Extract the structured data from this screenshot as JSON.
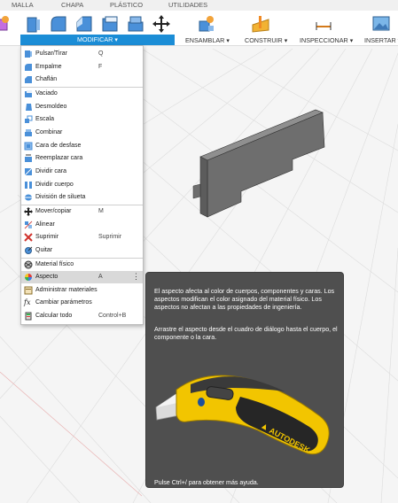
{
  "tabs": [
    "MALLA",
    "CHAPA",
    "PLÁSTICO",
    "UTILIDADES"
  ],
  "toolbar": {
    "modificar_label": "MODIFICAR ▾",
    "groups": [
      "ENSAMBLAR ▾",
      "CONSTRUIR ▾",
      "INSPECCIONAR ▾",
      "INSERTAR ▾"
    ]
  },
  "menu": {
    "items": [
      {
        "label": "Pulsar/Tirar",
        "shortcut": "Q",
        "icon": "push-pull-icon"
      },
      {
        "label": "Empalme",
        "shortcut": "F",
        "icon": "fillet-icon"
      },
      {
        "label": "Chaflán",
        "shortcut": "",
        "icon": "chamfer-icon"
      },
      {
        "label": "Vaciado",
        "shortcut": "",
        "icon": "shell-icon"
      },
      {
        "label": "Desmoldeo",
        "shortcut": "",
        "icon": "draft-icon"
      },
      {
        "label": "Escala",
        "shortcut": "",
        "icon": "scale-icon"
      },
      {
        "label": "Combinar",
        "shortcut": "",
        "icon": "combine-icon"
      },
      {
        "label": "Cara de desfase",
        "shortcut": "",
        "icon": "offset-face-icon"
      },
      {
        "label": "Reemplazar cara",
        "shortcut": "",
        "icon": "replace-face-icon"
      },
      {
        "label": "Dividir cara",
        "shortcut": "",
        "icon": "split-face-icon"
      },
      {
        "label": "Dividir cuerpo",
        "shortcut": "",
        "icon": "split-body-icon"
      },
      {
        "label": "División de silueta",
        "shortcut": "",
        "icon": "silhouette-split-icon"
      },
      {
        "label": "Mover/copiar",
        "shortcut": "M",
        "icon": "move-icon"
      },
      {
        "label": "Alinear",
        "shortcut": "",
        "icon": "align-icon"
      },
      {
        "label": "Suprimir",
        "shortcut": "Suprimir",
        "icon": "delete-icon"
      },
      {
        "label": "Quitar",
        "shortcut": "",
        "icon": "remove-icon"
      },
      {
        "label": "Material físico",
        "shortcut": "",
        "icon": "physical-material-icon"
      },
      {
        "label": "Aspecto",
        "shortcut": "A",
        "icon": "appearance-icon"
      },
      {
        "label": "Administrar materiales",
        "shortcut": "",
        "icon": "manage-materials-icon"
      },
      {
        "label": "Cambiar parámetros",
        "shortcut": "",
        "icon": "parameters-icon"
      },
      {
        "label": "Calcular todo",
        "shortcut": "Control+B",
        "icon": "compute-all-icon"
      }
    ]
  },
  "tooltip": {
    "para1": "El aspecto afecta al color de cuerpos, componentes y caras. Los aspectos modifican el color asignado del material físico. Los aspectos no afectan a las propiedades de ingeniería.",
    "para2": "Arrastre el aspecto desde el cuadro de diálogo hasta el cuerpo, el componente o la cara.",
    "footer": "Pulse Ctrl+/ para obtener más ayuda.",
    "brand": "AUTODESK"
  },
  "colors": {
    "accent": "#1b8dd6",
    "tooltip_bg": "#4f4f4f",
    "highlight": "#d9d9d9",
    "knife_yellow": "#f2c500",
    "body_gray": "#666666"
  }
}
